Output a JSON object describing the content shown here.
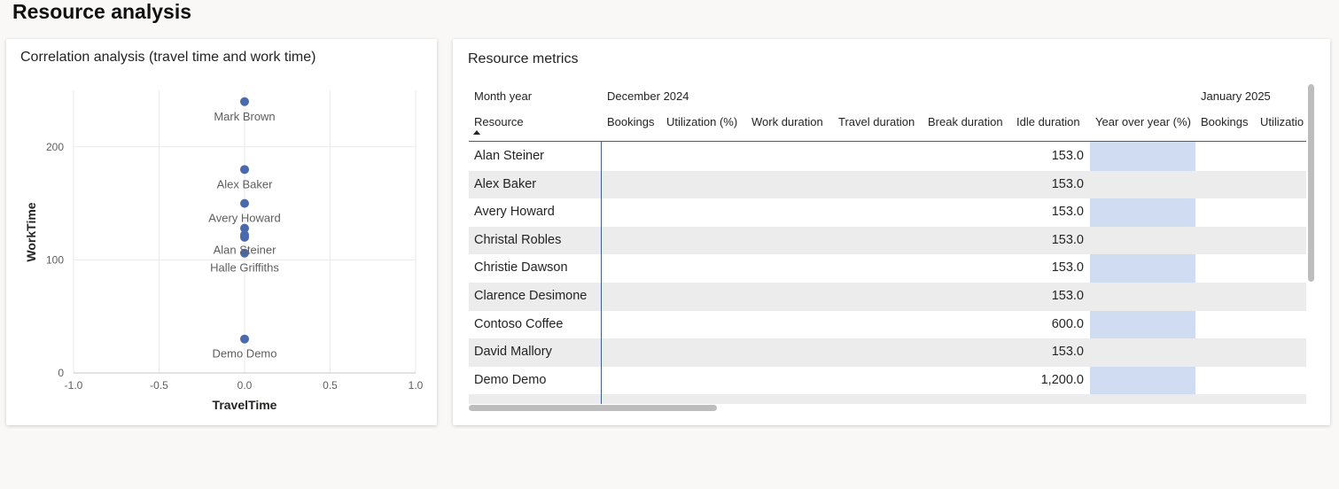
{
  "page": {
    "title": "Resource analysis"
  },
  "scatter": {
    "title": "Correlation analysis (travel time and work time)"
  },
  "chart_data": {
    "type": "scatter",
    "title": "Correlation analysis (travel time and work time)",
    "xlabel": "TravelTime",
    "ylabel": "WorkTime",
    "xlim": [
      -1.0,
      1.0
    ],
    "ylim": [
      0,
      250
    ],
    "x_ticks": [
      "-1.0",
      "-0.5",
      "0.0",
      "0.5",
      "1.0"
    ],
    "y_ticks": [
      "0",
      "100",
      "200"
    ],
    "grid": true,
    "points": [
      {
        "label": "Mark Brown",
        "x": 0.0,
        "y": 240
      },
      {
        "label": "Alex Baker",
        "x": 0.0,
        "y": 180
      },
      {
        "label": "Avery Howard",
        "x": 0.0,
        "y": 150
      },
      {
        "label": "",
        "x": 0.0,
        "y": 128
      },
      {
        "label": "Alan Steiner",
        "x": 0.0,
        "y": 122
      },
      {
        "label": "",
        "x": 0.0,
        "y": 120
      },
      {
        "label": "Halle Griffiths",
        "x": 0.0,
        "y": 106
      },
      {
        "label": "Demo Demo",
        "x": 0.0,
        "y": 30
      }
    ],
    "point_color": "#4a6ab0"
  },
  "table": {
    "title": "Resource metrics",
    "row1": {
      "label": "Month year",
      "dec": "December 2024",
      "jan": "January 2025"
    },
    "columns": {
      "resource": "Resource",
      "bookings": "Bookings",
      "utilization": "Utilization (%)",
      "work": "Work duration",
      "travel": "Travel duration",
      "break_d": "Break duration",
      "idle": "Idle duration",
      "yoy": "Year over year (%)",
      "bookings2": "Bookings",
      "utilization2": "Utilizatio"
    },
    "rows": [
      {
        "name": "Alan Steiner",
        "idle": "153.0"
      },
      {
        "name": "Alex Baker",
        "idle": "153.0"
      },
      {
        "name": "Avery Howard",
        "idle": "153.0"
      },
      {
        "name": "Christal Robles",
        "idle": "153.0"
      },
      {
        "name": "Christie Dawson",
        "idle": "153.0"
      },
      {
        "name": "Clarence Desimone",
        "idle": "153.0"
      },
      {
        "name": "Contoso Coffee",
        "idle": "600.0"
      },
      {
        "name": "David Mallory",
        "idle": "153.0"
      },
      {
        "name": "Demo Demo",
        "idle": "1,200.0"
      }
    ],
    "highlight_color": "#ccd9f1",
    "accent_color": "#3b5cad"
  }
}
